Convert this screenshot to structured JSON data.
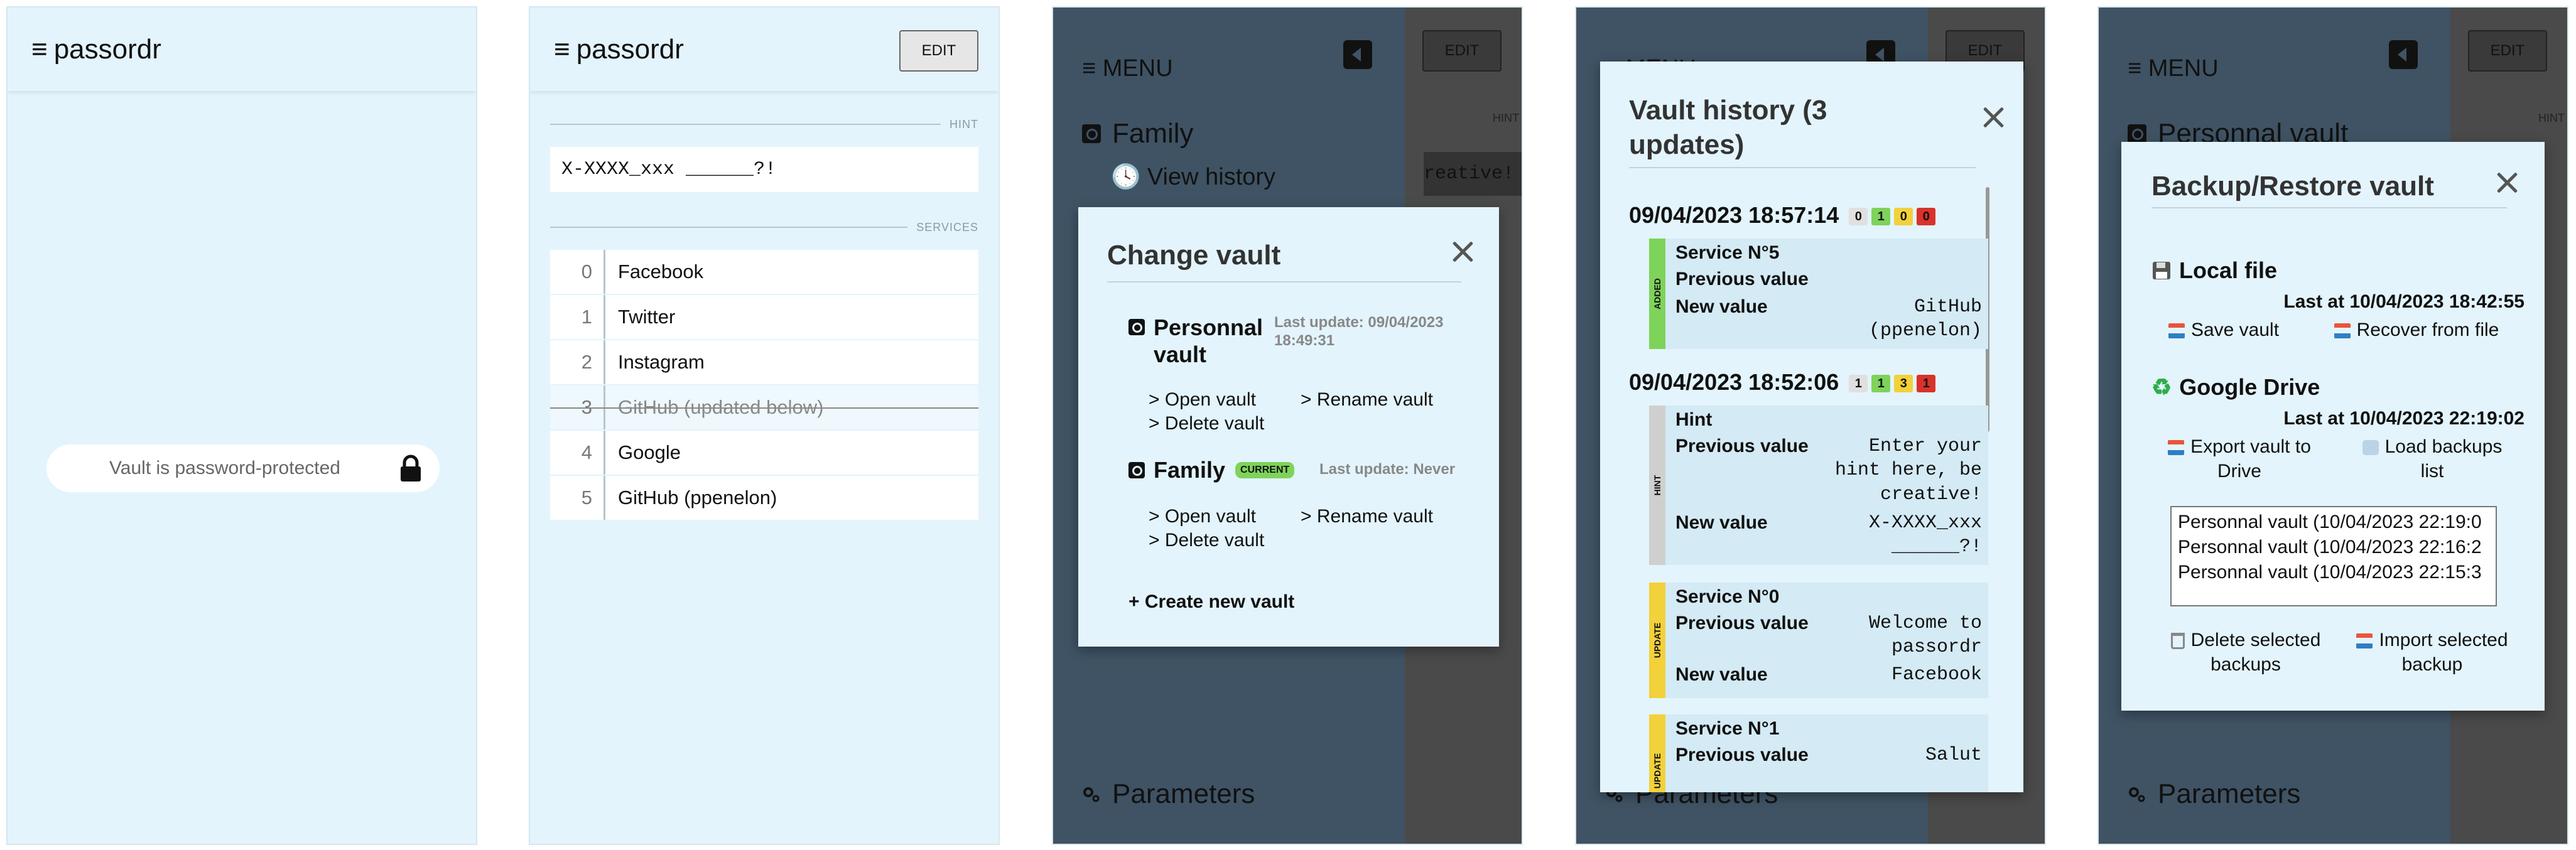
{
  "app": {
    "brand": "passordr",
    "hamburger": "≡"
  },
  "screen1": {
    "locked_text": "Vault is password-protected"
  },
  "screen2": {
    "edit_label": "EDIT",
    "hint_section": "HINT",
    "hint_value": "X-XXXX_xxx ______?!",
    "services_section": "SERVICES",
    "services": [
      {
        "index": "0",
        "name": "Facebook"
      },
      {
        "index": "1",
        "name": "Twitter"
      },
      {
        "index": "2",
        "name": "Instagram"
      },
      {
        "index": "3",
        "name": "GitHub (updated below)"
      },
      {
        "index": "4",
        "name": "Google"
      },
      {
        "index": "5",
        "name": "GitHub (ppenelon)"
      }
    ]
  },
  "menu": {
    "title": "MENU",
    "edit_label": "EDIT",
    "hint_label": "HINT",
    "current_vault": "Family",
    "view_history": "View history",
    "parameters": "Parameters",
    "behind_hint": "reative!",
    "personal_vault": "Personnal vault"
  },
  "change_vault": {
    "title": "Change vault",
    "vaults": [
      {
        "name": "Personnal vault",
        "last_update": "Last update: 09/04/2023 18:49:31",
        "open": "> Open vault",
        "rename": "> Rename vault",
        "delete": "> Delete vault"
      },
      {
        "name": "Family",
        "badge": "CURRENT",
        "last_update": "Last update: Never",
        "open": "> Open vault",
        "rename": "> Rename vault",
        "delete": "> Delete vault"
      }
    ],
    "create": "+ Create new vault"
  },
  "history": {
    "title_line1": "Vault history (3",
    "title_line2": "updates)",
    "entries": [
      {
        "timestamp": "09/04/2023 18:57:14",
        "counts": [
          "0",
          "1",
          "0",
          "0"
        ],
        "cards": [
          {
            "tag": "ADDED",
            "service": "Service N°5",
            "previous_label": "Previous value",
            "previous_value": "",
            "new_label": "New value",
            "new_value": "GitHub\n(ppenelon)"
          }
        ]
      },
      {
        "timestamp": "09/04/2023 18:52:06",
        "counts": [
          "1",
          "1",
          "3",
          "1"
        ],
        "cards": [
          {
            "tag": "HINT",
            "service": "Hint",
            "previous_label": "Previous value",
            "previous_value": "Enter your\nhint here, be\ncreative!",
            "new_label": "New value",
            "new_value": "X-XXXX_xxx\n______?!"
          },
          {
            "tag": "UPDATE",
            "service": "Service N°0",
            "previous_label": "Previous value",
            "previous_value": "Welcome to\npassordr",
            "new_label": "New value",
            "new_value": "Facebook"
          },
          {
            "tag": "UPDATE",
            "service": "Service N°1",
            "previous_label": "Previous value",
            "previous_value": "Salut",
            "new_label": "",
            "new_value": ""
          }
        ]
      }
    ],
    "pill_colors": [
      "#e0e0e0",
      "#7ed35a",
      "#f2d13a",
      "#d9322b"
    ]
  },
  "backup": {
    "title": "Backup/Restore vault",
    "local_title": "Local file",
    "local_last": "Last at 10/04/2023 18:42:55",
    "save_vault": "Save vault",
    "recover": "Recover from file",
    "drive_title": "Google Drive",
    "drive_last": "Last at 10/04/2023 22:19:02",
    "export_line1": "Export vault to",
    "export_line2": "Drive",
    "load_line1": "Load backups",
    "load_line2": "list",
    "backups": [
      "Personnal vault (10/04/2023 22:19:0",
      "Personnal vault (10/04/2023 22:16:2",
      "Personnal vault (10/04/2023 22:15:3"
    ],
    "delete_line1": "Delete selected",
    "delete_line2": "backups",
    "import_line1": "Import selected",
    "import_line2": "backup"
  },
  "colors": {
    "light_bg": "#e3f4fc",
    "menu_bg": "#3f5364",
    "overlay": "#4a4a4a",
    "added": "#7ed35a",
    "update": "#f2d13a",
    "hint": "#cfcfcf"
  }
}
